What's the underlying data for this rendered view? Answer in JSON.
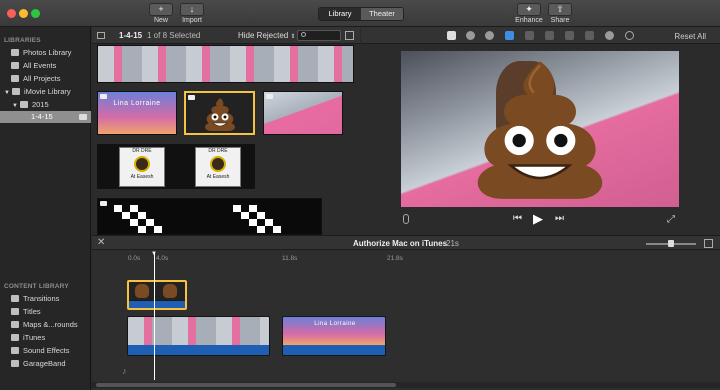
{
  "toolbar": {
    "new_label": "New",
    "import_label": "Import",
    "library_label": "Library",
    "theater_label": "Theater",
    "enhance_label": "Enhance",
    "share_label": "Share"
  },
  "sidebar": {
    "libraries_heading": "LIBRARIES",
    "items": [
      {
        "label": "Photos Library"
      },
      {
        "label": "All Events"
      },
      {
        "label": "All Projects"
      },
      {
        "label": "iMovie Library"
      },
      {
        "label": "2015"
      },
      {
        "label": "1-4-15"
      }
    ],
    "content_heading": "CONTENT LIBRARY",
    "content_items": [
      {
        "label": "Transitions"
      },
      {
        "label": "Titles"
      },
      {
        "label": "Maps &...rounds"
      },
      {
        "label": "iTunes"
      },
      {
        "label": "Sound Effects"
      },
      {
        "label": "GarageBand"
      }
    ]
  },
  "browser": {
    "event_name": "1-4-15",
    "selection_status": "1 of 8 Selected",
    "filter_value": "Hide Rejected",
    "clip_title_text": "Lina Lorraine",
    "dre_text": "DR DRE",
    "dre_caption": "At Easesh"
  },
  "viewer": {
    "reset_label": "Reset All"
  },
  "timeline": {
    "project_title": "Authorize Mac on iTunes",
    "duration": "21s",
    "ruler": [
      "0.0s",
      "4.0s",
      "11.8s",
      "21.8s"
    ],
    "clip_title_text": "Lina Lorraine"
  },
  "colors": {
    "selection_yellow": "#f5c242",
    "audio_blue": "#1e5fb3",
    "sidebar_selected": "#8f8f8f"
  }
}
